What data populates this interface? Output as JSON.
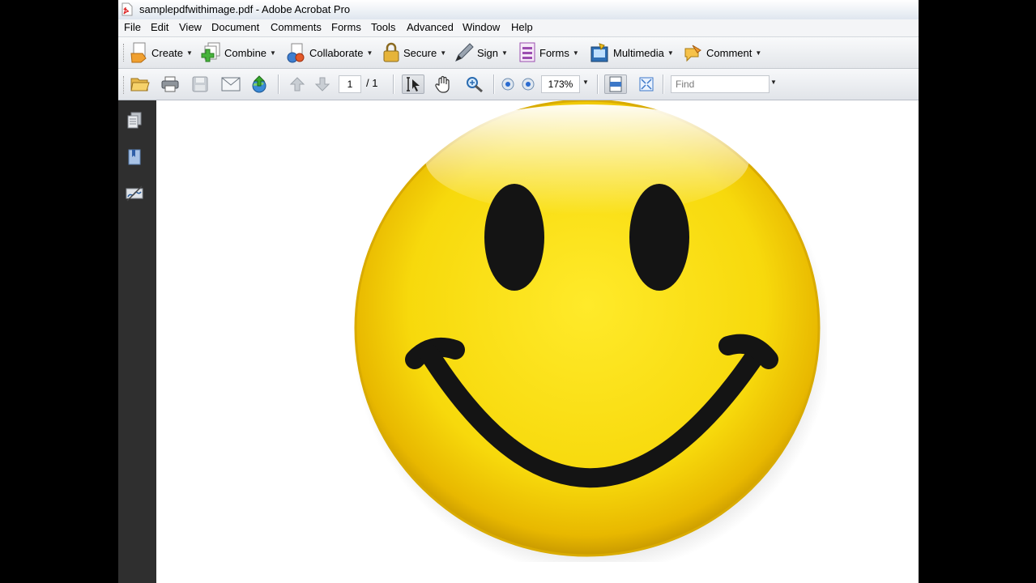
{
  "window": {
    "title": "samplepdfwithimage.pdf - Adobe Acrobat Pro"
  },
  "menu": {
    "items": [
      "File",
      "Edit",
      "View",
      "Document",
      "Comments",
      "Forms",
      "Tools",
      "Advanced",
      "Window",
      "Help"
    ]
  },
  "tasks": {
    "create": "Create",
    "combine": "Combine",
    "collaborate": "Collaborate",
    "secure": "Secure",
    "sign": "Sign",
    "forms": "Forms",
    "multimedia": "Multimedia",
    "comment": "Comment"
  },
  "toolbar": {
    "page_current": "1",
    "page_total": "/ 1",
    "zoom": "173%",
    "find_placeholder": "Find"
  },
  "document": {
    "image": "smiley-face"
  },
  "colors": {
    "smiley_yellow": "#f7d90c",
    "smiley_features": "#141414",
    "nav_panel": "#2f2f2f"
  }
}
